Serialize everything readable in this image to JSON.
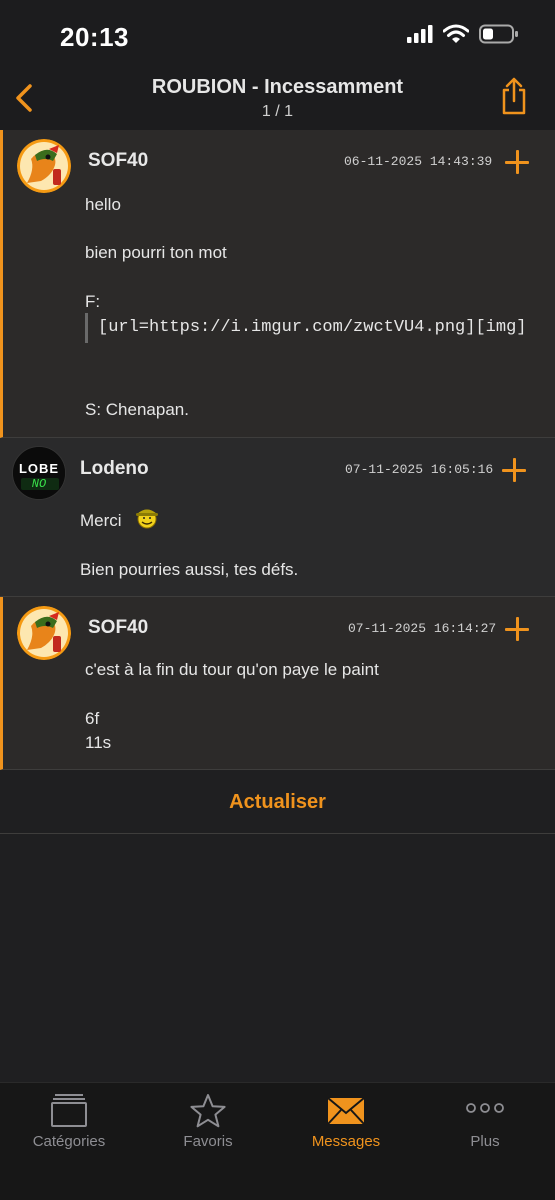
{
  "status": {
    "time": "20:13"
  },
  "nav": {
    "title": "ROUBION - Incessamment",
    "page": "1 / 1"
  },
  "posts": [
    {
      "author": "SOF40",
      "date": "06-11-2025 14:43:39",
      "lines": [
        "hello",
        "bien pourri ton mot",
        "F:"
      ],
      "quote": "[url=https://i.imgur.com/zwctVU4.png][img]",
      "signoff": "S: Chenapan."
    },
    {
      "author": "Lodeno",
      "date": "07-11-2025 16:05:16",
      "lines": [
        "Merci",
        "Bien pourries aussi, tes défs."
      ],
      "avatar_text": [
        "LOBE",
        "NO"
      ]
    },
    {
      "author": "SOF40",
      "date": "07-11-2025 16:14:27",
      "lines": [
        "c'est à la fin du tour qu'on paye le paint",
        "6f",
        "11s"
      ]
    }
  ],
  "refresh_label": "Actualiser",
  "tabs": [
    {
      "label": "Catégories",
      "icon": "categories-icon"
    },
    {
      "label": "Favoris",
      "icon": "star-icon"
    },
    {
      "label": "Messages",
      "icon": "envelope-icon",
      "active": true
    },
    {
      "label": "Plus",
      "icon": "more-icon"
    }
  ],
  "colors": {
    "accent": "#f0931d",
    "background": "#1f1f21",
    "post_bg": "#2c2a29"
  }
}
